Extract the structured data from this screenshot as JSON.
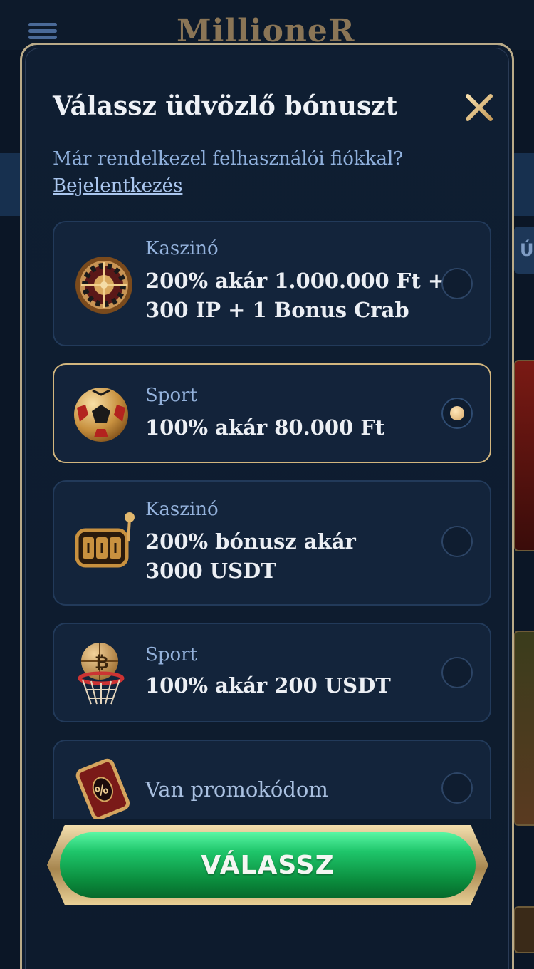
{
  "app": {
    "logo": "MillioneR"
  },
  "background": {
    "tab_label": "Ú"
  },
  "modal": {
    "title": "Válassz üdvözlő bónuszt",
    "close_icon": "close-icon",
    "subtitle": "Már rendelkezel felhasználói fiókkal?",
    "login_link": "Bejelentkezés",
    "options": [
      {
        "icon": "roulette-icon",
        "category": "Kaszinó",
        "line1": "200% akár 1.000.000 Ft +",
        "line2": "300 IP + 1 Bonus Crab",
        "selected": false
      },
      {
        "icon": "soccer-ball-icon",
        "category": "Sport",
        "line1": "100% akár 80.000 Ft",
        "line2": "",
        "selected": true
      },
      {
        "icon": "slot-machine-icon",
        "category": "Kaszinó",
        "line1": "200% bónusz akár",
        "line2": "3000 USDT",
        "selected": false
      },
      {
        "icon": "basketball-hoop-icon",
        "category": "Sport",
        "line1": "100% akár 200 USDT",
        "line2": "",
        "selected": false
      },
      {
        "icon": "promo-ticket-icon",
        "category": "",
        "line1": "Van promokódom",
        "line2": "",
        "selected": false
      }
    ],
    "submit_label": "VÁLASSZ"
  },
  "colors": {
    "accent_gold": "#d2b67e",
    "button_green": "#1ec56a",
    "background": "#0b1626"
  }
}
